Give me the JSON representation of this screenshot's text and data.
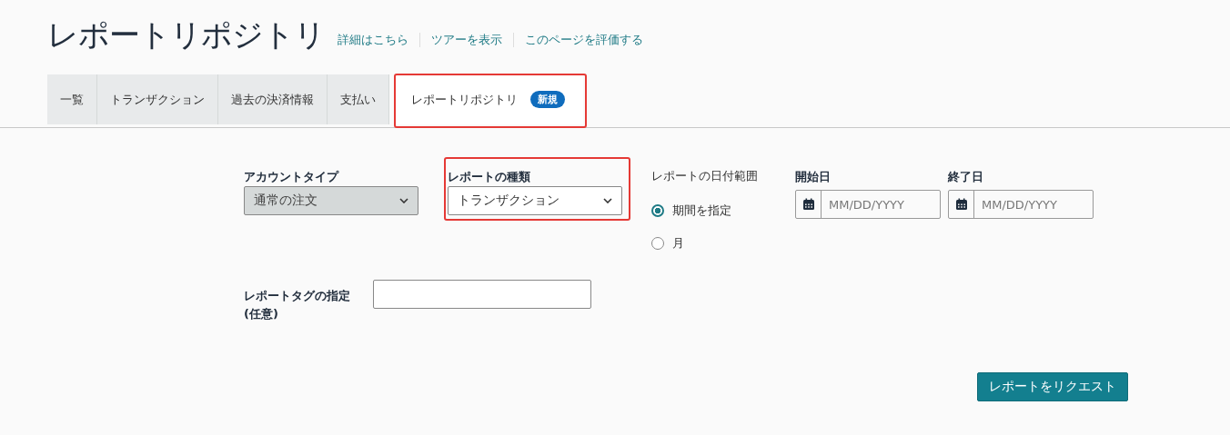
{
  "header": {
    "title": "レポートリポジトリ",
    "links": [
      "詳細はこちら",
      "ツアーを表示",
      "このページを評価する"
    ]
  },
  "tabs": [
    {
      "label": "一覧",
      "selected": false,
      "highlighted": false
    },
    {
      "label": "トランザクション",
      "selected": false,
      "highlighted": false
    },
    {
      "label": "過去の決済情報",
      "selected": false,
      "highlighted": false
    },
    {
      "label": "支払い",
      "selected": false,
      "highlighted": false
    },
    {
      "label": "レポートリポジトリ",
      "selected": true,
      "highlighted": true,
      "badge": "新規"
    }
  ],
  "form": {
    "account_type": {
      "label": "アカウントタイプ",
      "value": "通常の注文",
      "disabled": true
    },
    "report_type": {
      "label": "レポートの種類",
      "value": "トランザクション",
      "disabled": false,
      "highlighted": true
    },
    "date_range": {
      "label": "レポートの日付範囲",
      "options": [
        {
          "label": "期間を指定",
          "selected": true
        },
        {
          "label": "月",
          "selected": false
        }
      ]
    },
    "start_date": {
      "label": "開始日",
      "placeholder": "MM/DD/YYYY"
    },
    "end_date": {
      "label": "終了日",
      "placeholder": "MM/DD/YYYY"
    },
    "report_tag": {
      "label": "レポートタグの指定",
      "sublabel": "(任意)"
    },
    "submit": "レポートをリクエスト"
  }
}
